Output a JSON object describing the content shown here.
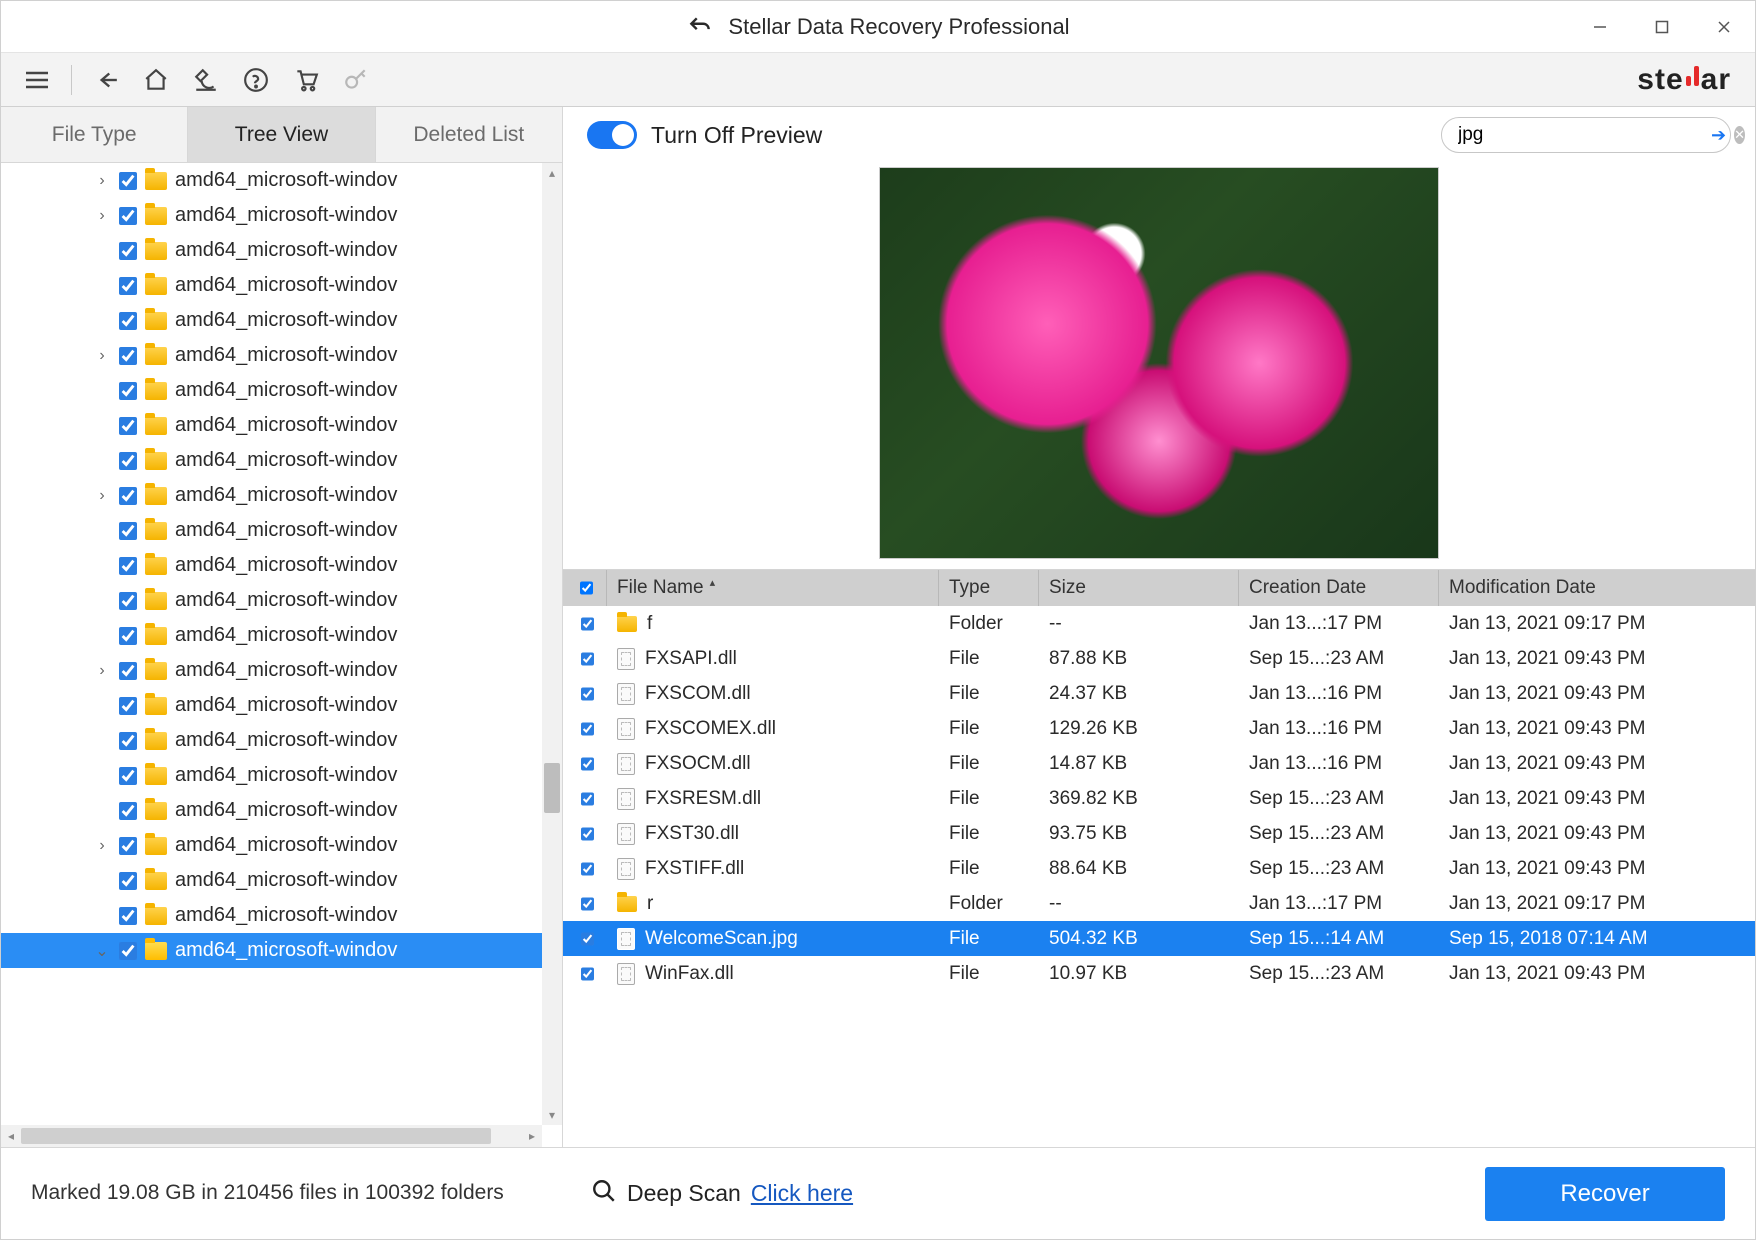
{
  "title": "Stellar Data Recovery Professional",
  "brand_prefix": "ste",
  "brand_suffix": "ar",
  "tabs": {
    "file_type": "File Type",
    "tree_view": "Tree View",
    "deleted_list": "Deleted List"
  },
  "tree": {
    "items": [
      {
        "expander": "›",
        "name": "amd64_microsoft-windov"
      },
      {
        "expander": "›",
        "name": "amd64_microsoft-windov"
      },
      {
        "expander": "",
        "name": "amd64_microsoft-windov"
      },
      {
        "expander": "",
        "name": "amd64_microsoft-windov"
      },
      {
        "expander": "",
        "name": "amd64_microsoft-windov"
      },
      {
        "expander": "›",
        "name": "amd64_microsoft-windov"
      },
      {
        "expander": "",
        "name": "amd64_microsoft-windov"
      },
      {
        "expander": "",
        "name": "amd64_microsoft-windov"
      },
      {
        "expander": "",
        "name": "amd64_microsoft-windov"
      },
      {
        "expander": "›",
        "name": "amd64_microsoft-windov"
      },
      {
        "expander": "",
        "name": "amd64_microsoft-windov"
      },
      {
        "expander": "",
        "name": "amd64_microsoft-windov"
      },
      {
        "expander": "",
        "name": "amd64_microsoft-windov"
      },
      {
        "expander": "",
        "name": "amd64_microsoft-windov"
      },
      {
        "expander": "›",
        "name": "amd64_microsoft-windov"
      },
      {
        "expander": "",
        "name": "amd64_microsoft-windov"
      },
      {
        "expander": "",
        "name": "amd64_microsoft-windov"
      },
      {
        "expander": "",
        "name": "amd64_microsoft-windov"
      },
      {
        "expander": "",
        "name": "amd64_microsoft-windov"
      },
      {
        "expander": "›",
        "name": "amd64_microsoft-windov"
      },
      {
        "expander": "",
        "name": "amd64_microsoft-windov"
      },
      {
        "expander": "",
        "name": "amd64_microsoft-windov"
      },
      {
        "expander": "⌄",
        "name": "amd64_microsoft-windov",
        "selected": true
      }
    ]
  },
  "preview_toggle_label": "Turn Off Preview",
  "search_value": "jpg",
  "table": {
    "headers": {
      "name": "File Name",
      "type": "Type",
      "size": "Size",
      "cd": "Creation Date",
      "md": "Modification Date"
    },
    "rows": [
      {
        "icon": "folder",
        "name": "f",
        "type": "Folder",
        "size": "--",
        "cd": "Jan 13...:17 PM",
        "md": "Jan 13, 2021 09:17 PM"
      },
      {
        "icon": "file",
        "name": "FXSAPI.dll",
        "type": "File",
        "size": "87.88 KB",
        "cd": "Sep 15...:23 AM",
        "md": "Jan 13, 2021 09:43 PM"
      },
      {
        "icon": "file",
        "name": "FXSCOM.dll",
        "type": "File",
        "size": "24.37 KB",
        "cd": "Jan 13...:16 PM",
        "md": "Jan 13, 2021 09:43 PM"
      },
      {
        "icon": "file",
        "name": "FXSCOMEX.dll",
        "type": "File",
        "size": "129.26 KB",
        "cd": "Jan 13...:16 PM",
        "md": "Jan 13, 2021 09:43 PM"
      },
      {
        "icon": "file",
        "name": "FXSOCM.dll",
        "type": "File",
        "size": "14.87 KB",
        "cd": "Jan 13...:16 PM",
        "md": "Jan 13, 2021 09:43 PM"
      },
      {
        "icon": "file",
        "name": "FXSRESM.dll",
        "type": "File",
        "size": "369.82 KB",
        "cd": "Sep 15...:23 AM",
        "md": "Jan 13, 2021 09:43 PM"
      },
      {
        "icon": "file",
        "name": "FXST30.dll",
        "type": "File",
        "size": "93.75 KB",
        "cd": "Sep 15...:23 AM",
        "md": "Jan 13, 2021 09:43 PM"
      },
      {
        "icon": "file",
        "name": "FXSTIFF.dll",
        "type": "File",
        "size": "88.64 KB",
        "cd": "Sep 15...:23 AM",
        "md": "Jan 13, 2021 09:43 PM"
      },
      {
        "icon": "folder",
        "name": "r",
        "type": "Folder",
        "size": "--",
        "cd": "Jan 13...:17 PM",
        "md": "Jan 13, 2021 09:17 PM"
      },
      {
        "icon": "file",
        "name": "WelcomeScan.jpg",
        "type": "File",
        "size": "504.32 KB",
        "cd": "Sep 15...:14 AM",
        "md": "Sep 15, 2018 07:14 AM",
        "selected": true
      },
      {
        "icon": "file",
        "name": "WinFax.dll",
        "type": "File",
        "size": "10.97 KB",
        "cd": "Sep 15...:23 AM",
        "md": "Jan 13, 2021 09:43 PM"
      }
    ]
  },
  "footer": {
    "status": "Marked 19.08 GB in 210456 files in 100392 folders",
    "deepscan_label": "Deep Scan",
    "deepscan_link": "Click here",
    "recover": "Recover"
  }
}
